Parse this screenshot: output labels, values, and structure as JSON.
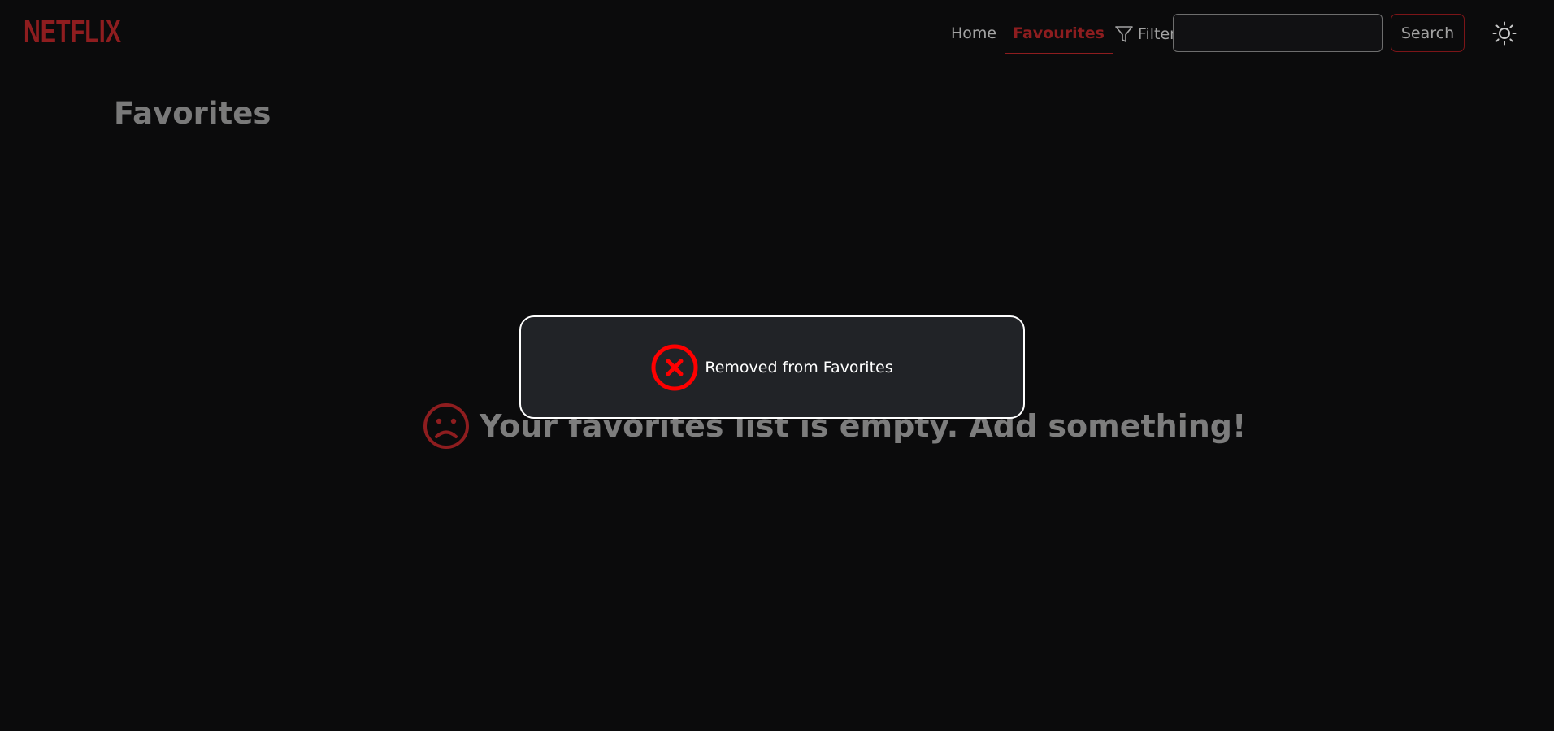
{
  "header": {
    "logo_text": "NETFLIX",
    "nav": {
      "home_label": "Home",
      "favourites_label": "Favourites",
      "filter_label": "Filter"
    },
    "search": {
      "value": "",
      "placeholder": "",
      "button_label": "Search"
    },
    "theme_toggle_icon": "sun-icon"
  },
  "main": {
    "title": "Favorites",
    "empty_icon": "frown-face-icon",
    "empty_message": "Your favorites list is empty. Add something!"
  },
  "toast": {
    "icon": "close-circle-icon",
    "message": "Removed from Favorites"
  },
  "colors": {
    "background": "#0b0b0c",
    "brand_red": "#8e1d1f",
    "toast_background": "#212327",
    "toast_icon_red": "#ff0000",
    "muted_text": "#a3a3a3"
  }
}
